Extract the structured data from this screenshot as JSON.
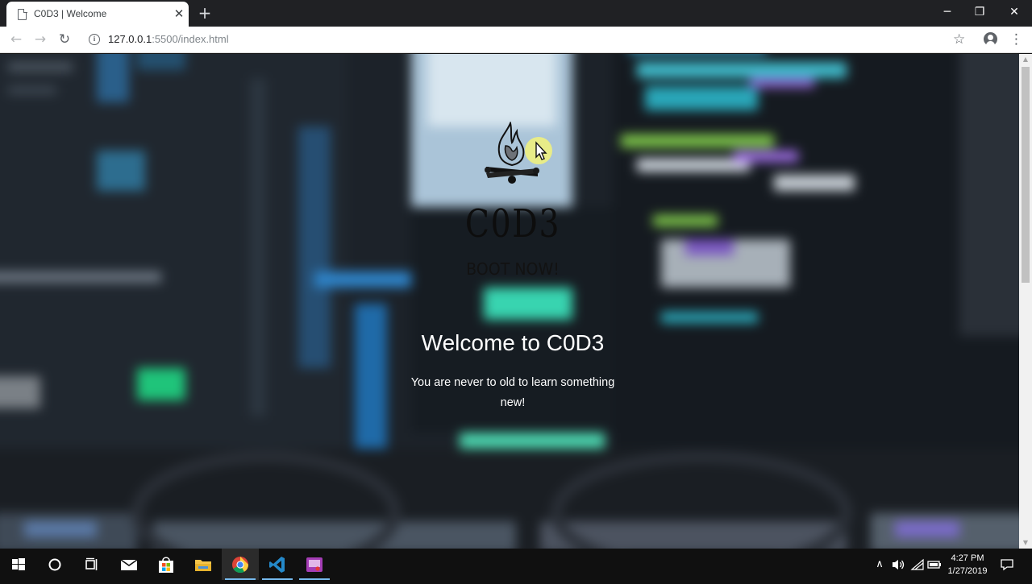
{
  "browser": {
    "tab": {
      "title": "C0D3 | Welcome",
      "icon": "page-icon",
      "close": "✕"
    },
    "new_tab": "+",
    "window_controls": {
      "minimize": "─",
      "maximize": "❐",
      "close": "✕"
    },
    "nav": {
      "back": "←",
      "forward": "→",
      "reload": "↻"
    },
    "address": {
      "host": "127.0.0.1",
      "path": ":5500/index.html"
    },
    "bookmark": "☆",
    "menu": "⋮"
  },
  "page": {
    "logo_icon": "campfire-icon",
    "brand": "C0D3",
    "tagline": "BOOT NOW!",
    "welcome": "Welcome to C0D3",
    "subtitle": "You are never to old to learn something new!"
  },
  "taskbar": {
    "apps": [
      "windows-start-icon",
      "cortana-search-icon",
      "task-view-icon",
      "mail-icon",
      "store-icon",
      "file-explorer-icon",
      "chrome-icon",
      "vscode-icon",
      "recorder-app-icon"
    ],
    "tray": {
      "chevron": "∧"
    },
    "clock": {
      "time": "4:27 PM",
      "date": "1/27/2019"
    }
  },
  "colors": {
    "titlebar": "#202124",
    "taskbar": "#101010",
    "accent": "#76b9ed",
    "hero_text": "#ffffff"
  }
}
